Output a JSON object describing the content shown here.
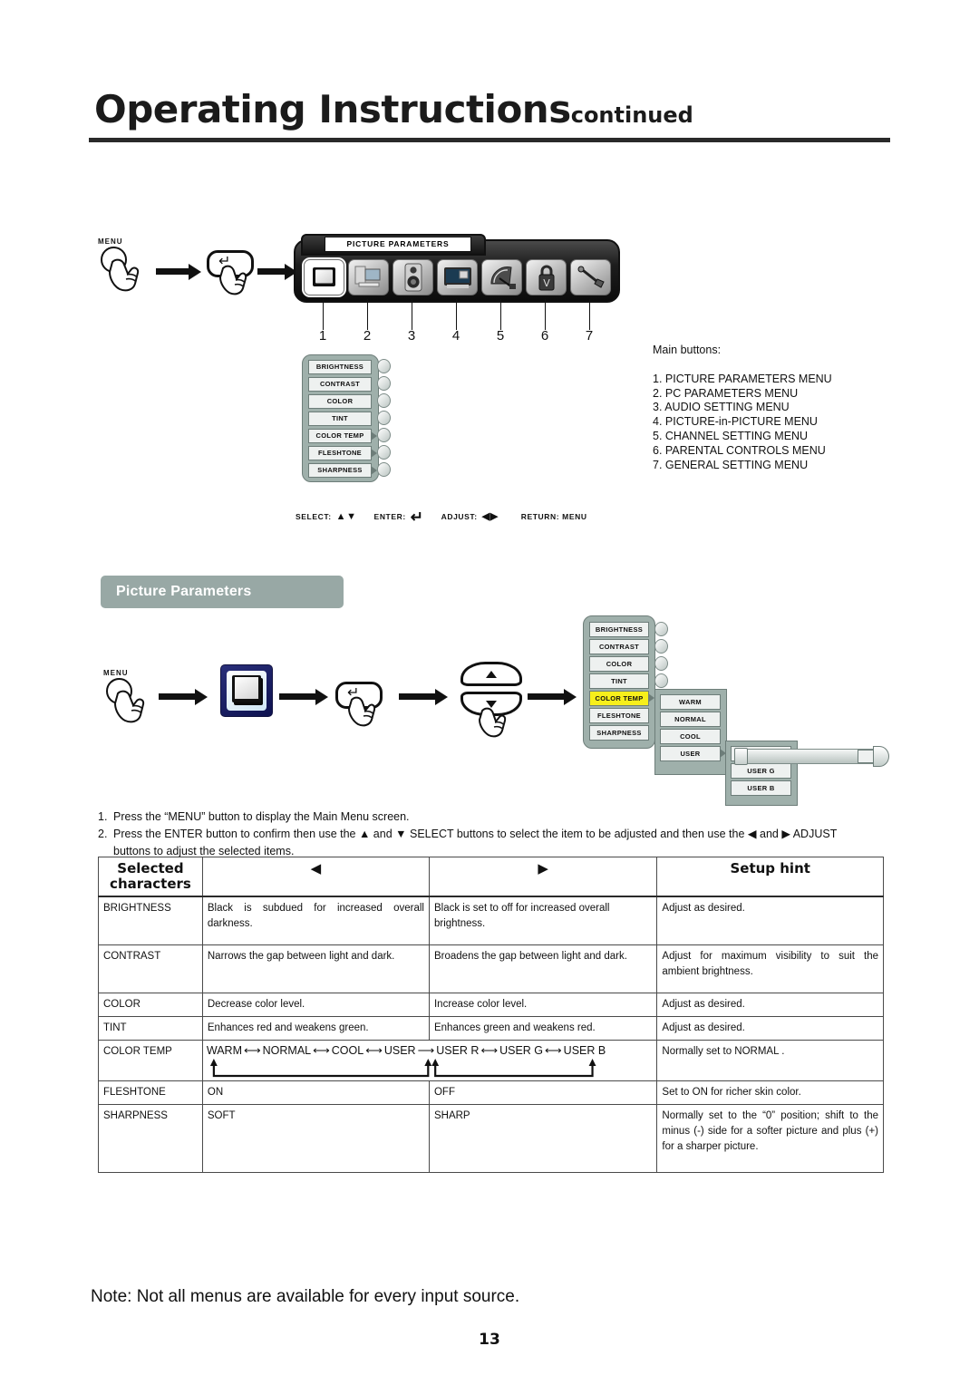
{
  "header": {
    "title": "Operating Instructions",
    "title_suffix": "continued"
  },
  "top_diagram": {
    "menu_button_label": "MENU",
    "osd_title": "PICTURE PARAMETERS",
    "icons": [
      {
        "num": "1",
        "name": "tv-icon",
        "selected": true
      },
      {
        "num": "2",
        "name": "pc-monitor-icon",
        "selected": false
      },
      {
        "num": "3",
        "name": "speaker-icon",
        "selected": false
      },
      {
        "num": "4",
        "name": "picture-in-picture-icon",
        "selected": false
      },
      {
        "num": "5",
        "name": "satellite-dish-icon",
        "selected": false
      },
      {
        "num": "6",
        "name": "padlock-icon",
        "selected": false
      },
      {
        "num": "7",
        "name": "tools-icon",
        "selected": false
      }
    ],
    "menu_items": [
      "BRIGHTNESS",
      "CONTRAST",
      "COLOR",
      "TINT",
      "COLOR TEMP",
      "FLESHTONE",
      "SHARPNESS"
    ],
    "legend": [
      {
        "label": "SELECT:",
        "glyph": "▲▼"
      },
      {
        "label": "ENTER:",
        "glyph": "↵"
      },
      {
        "label": "ADJUST:",
        "glyph": "◀▶"
      },
      {
        "label": "RETURN: MENU",
        "glyph": ""
      }
    ],
    "main_buttons_heading": "Main buttons:",
    "main_buttons": [
      "1. PICTURE PARAMETERS MENU",
      "2. PC PARAMETERS MENU",
      "3. AUDIO SETTING MENU",
      "4. PICTURE-in-PICTURE MENU",
      "5. CHANNEL SETTING MENU",
      "6. PARENTAL CONTROLS MENU",
      "7. GENERAL SETTING MENU"
    ]
  },
  "section": {
    "heading": "Picture Parameters",
    "menu_button_label": "MENU",
    "menu_items": [
      "BRIGHTNESS",
      "CONTRAST",
      "COLOR",
      "TINT",
      "COLOR TEMP",
      "FLESHTONE",
      "SHARPNESS"
    ],
    "highlighted_item": "COLOR TEMP",
    "submenu_items": [
      "WARM",
      "NORMAL",
      "COOL",
      "USER"
    ],
    "submenu_highlighted": "USER",
    "user_items": [
      "USER R",
      "USER G",
      "USER B"
    ]
  },
  "steps": [
    {
      "num": "1.",
      "text": "Press the “MENU” button to display the Main Menu screen."
    },
    {
      "num": "2.",
      "text": "Press the ENTER button to confirm then use the ▲ and ▼ SELECT buttons to select the item to be adjusted and then use the ◀ and ▶ ADJUST",
      "cont": "buttons to adjust the selected items."
    }
  ],
  "table": {
    "headers": {
      "col1": "Selected characters",
      "col1_line1": "Selected",
      "col1_line2": "characters",
      "col2": "◀",
      "col3": "▶",
      "col4": "Setup hint"
    },
    "rows": [
      {
        "name": "BRIGHTNESS",
        "left": "Black is subdued for increased overall darkness.",
        "right": "Black is set to off for increased overall brightness.",
        "hint": "Adjust as desired."
      },
      {
        "name": "CONTRAST",
        "left": "Narrows the gap between light and dark.",
        "right": "Broadens the gap between light and dark.",
        "hint": "Adjust for maximum visibility to suit the ambient brightness."
      },
      {
        "name": "COLOR",
        "left": "Decrease color level.",
        "right": "Increase color level.",
        "hint": "Adjust as desired."
      },
      {
        "name": "TINT",
        "left": "Enhances red and weakens green.",
        "right": "Enhances green and weakens red.",
        "hint": "Adjust as desired."
      },
      {
        "name": "COLOR TEMP",
        "sequence": [
          "WARM",
          "NORMAL",
          "COOL",
          "USER",
          "USER R",
          "USER G",
          "USER B"
        ],
        "hint": "Normally set to NORMAL ."
      },
      {
        "name": "FLESHTONE",
        "left": "ON",
        "right": "OFF",
        "hint": "Set to ON for richer skin color."
      },
      {
        "name": "SHARPNESS",
        "left": "SOFT",
        "right": "SHARP",
        "hint": "Normally set to the “0” position; shift to the minus (-) side for a softer picture and plus (+) for a sharper picture."
      }
    ]
  },
  "footer": {
    "note": "Note: Not all menus are available for every input source.",
    "page_number": "13"
  },
  "colors": {
    "heading_bg": "#98a8a5",
    "panel_bg": "#9fb0ab",
    "row_bg": "#eef1f0",
    "highlight": "#f7ef1b"
  }
}
